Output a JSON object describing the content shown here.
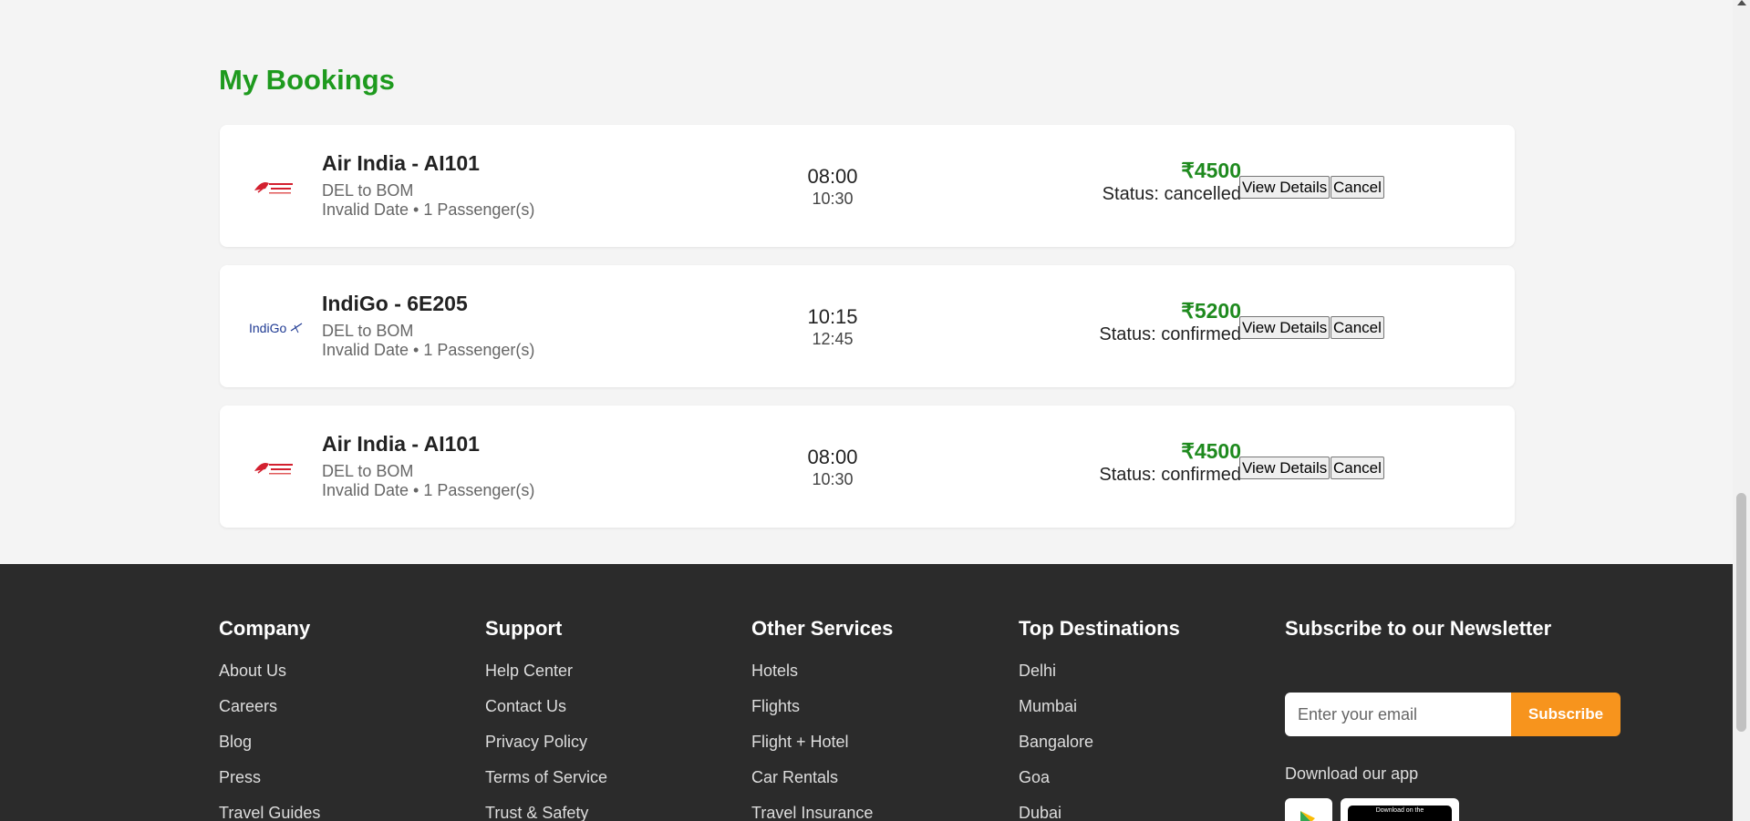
{
  "page_title": "My Bookings",
  "colors": {
    "accent_green": "#1e9a1e",
    "subscribe_orange": "#f7941d",
    "footer_bg": "#2b2b2b"
  },
  "bookings": [
    {
      "logo": "air-india-logo",
      "airline": "Air India - AI101",
      "route": "DEL to BOM",
      "meta": "Invalid Date • 1 Passenger(s)",
      "departure": "08:00",
      "arrival": "10:30",
      "price": "₹4500",
      "status": "Status: cancelled",
      "view_label": "View Details",
      "cancel_label": "Cancel"
    },
    {
      "logo": "indigo-logo",
      "logo_text": "IndiGo",
      "airline": "IndiGo - 6E205",
      "route": "DEL to BOM",
      "meta": "Invalid Date • 1 Passenger(s)",
      "departure": "10:15",
      "arrival": "12:45",
      "price": "₹5200",
      "status": "Status: confirmed",
      "view_label": "View Details",
      "cancel_label": "Cancel"
    },
    {
      "logo": "air-india-logo",
      "airline": "Air India - AI101",
      "route": "DEL to BOM",
      "meta": "Invalid Date • 1 Passenger(s)",
      "departure": "08:00",
      "arrival": "10:30",
      "price": "₹4500",
      "status": "Status: confirmed",
      "view_label": "View Details",
      "cancel_label": "Cancel"
    }
  ],
  "footer": {
    "company": {
      "title": "Company",
      "links": [
        "About Us",
        "Careers",
        "Blog",
        "Press",
        "Travel Guides"
      ]
    },
    "support": {
      "title": "Support",
      "links": [
        "Help Center",
        "Contact Us",
        "Privacy Policy",
        "Terms of Service",
        "Trust & Safety"
      ]
    },
    "services": {
      "title": "Other Services",
      "links": [
        "Hotels",
        "Flights",
        "Flight + Hotel",
        "Car Rentals",
        "Travel Insurance"
      ]
    },
    "destinations": {
      "title": "Top Destinations",
      "links": [
        "Delhi",
        "Mumbai",
        "Bangalore",
        "Goa",
        "Dubai"
      ]
    },
    "newsletter": {
      "title": "Subscribe to our Newsletter",
      "email_placeholder": "Enter your email",
      "subscribe_label": "Subscribe",
      "download_label": "Download our app",
      "app_store_text": "Download on the"
    }
  }
}
